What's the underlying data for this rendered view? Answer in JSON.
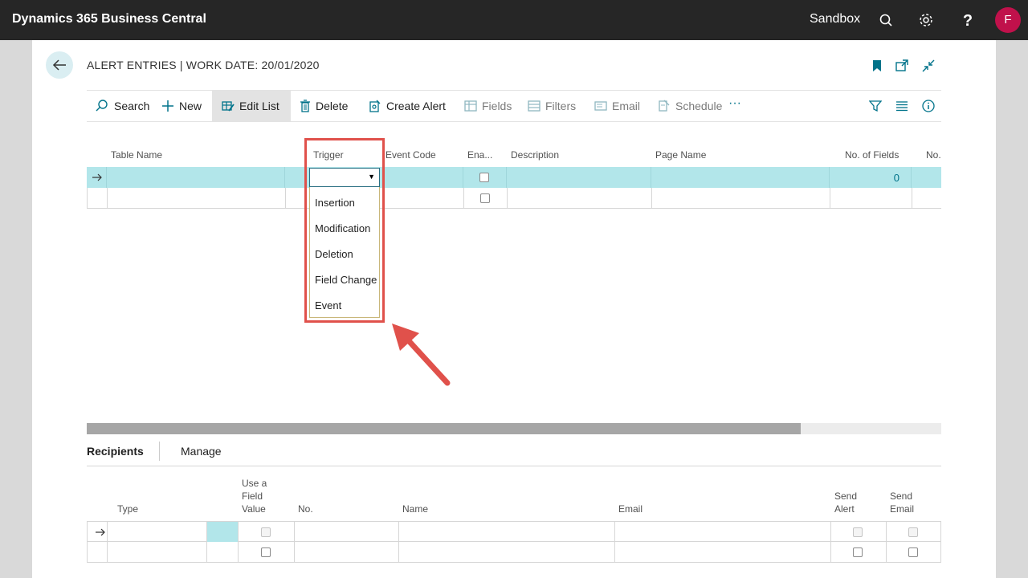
{
  "app": {
    "title": "Dynamics 365 Business Central",
    "environment": "Sandbox",
    "user_initial": "F",
    "icons": [
      "search-icon",
      "gear-icon",
      "help-icon"
    ]
  },
  "page": {
    "title": "ALERT ENTRIES | WORK DATE: 20/01/2020"
  },
  "actions": [
    {
      "label": "Search",
      "icon": "search-icon"
    },
    {
      "label": "New",
      "icon": "plus-icon"
    },
    {
      "label": "Edit List",
      "icon": "edit-list-icon"
    },
    {
      "label": "Delete",
      "icon": "trash-icon"
    },
    {
      "label": "Create Alert",
      "icon": "create-alert-icon"
    },
    {
      "label": "Fields",
      "icon": "fields-icon"
    },
    {
      "label": "Filters",
      "icon": "filters-icon"
    },
    {
      "label": "Email",
      "icon": "email-icon"
    },
    {
      "label": "Schedule",
      "icon": "schedule-icon"
    },
    {
      "label": "···",
      "icon": "more-icon"
    }
  ],
  "grid": {
    "columns": [
      "Table Name",
      "Trigger",
      "Event Code",
      "Ena...",
      "Description",
      "Page Name",
      "No. of Fields",
      "No."
    ],
    "rows": [
      {
        "table_name": "",
        "trigger": "",
        "event_code": "",
        "enabled": false,
        "description": "",
        "page_name": "",
        "no_of_fields": "0"
      },
      {
        "table_name": "",
        "trigger": "",
        "event_code": "",
        "enabled": false,
        "description": "",
        "page_name": "",
        "no_of_fields": ""
      }
    ]
  },
  "trigger_dropdown": {
    "selected": "",
    "arrow": "▼",
    "options": [
      "Insertion",
      "Modification",
      "Deletion",
      "Field Change",
      "Event"
    ]
  },
  "subpage": {
    "tabs": [
      "Recipients",
      "Manage"
    ],
    "columns": {
      "type": "Type",
      "use_field_value": "Use a\nField\nValue",
      "no": "No.",
      "name": "Name",
      "email": "Email",
      "send_alert": "Send\nAlert",
      "send_email": "Send\nEmail"
    }
  },
  "colors": {
    "appbar": "#262626",
    "accent": "#00738a",
    "selected_row": "#b2e6ea",
    "highlight": "#e0514b",
    "avatar": "#c0114b"
  }
}
